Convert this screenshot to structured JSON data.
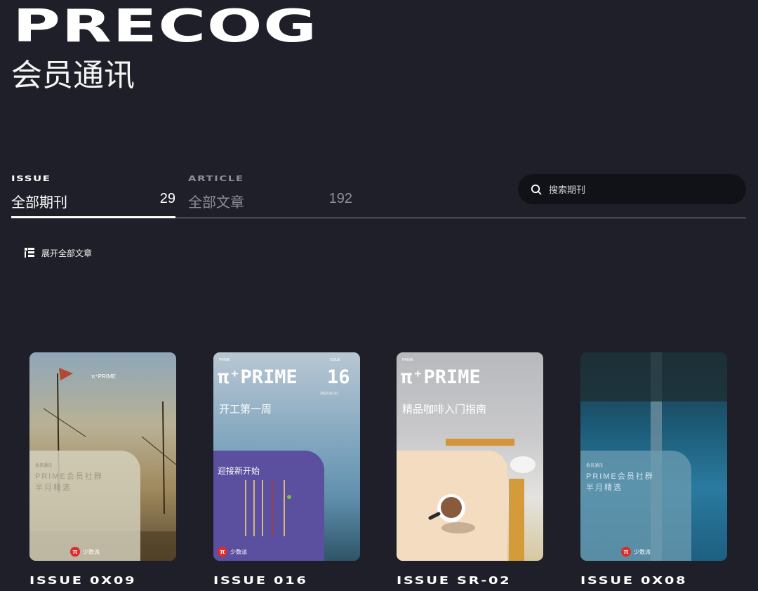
{
  "brand": "PRECOG",
  "subtitle": "会员通讯",
  "tabs": [
    {
      "kicker": "ISSUE",
      "label": "全部期刊",
      "count": "29"
    },
    {
      "kicker": "ARTICLE",
      "label": "全部文章",
      "count": "192"
    }
  ],
  "search": {
    "placeholder": "搜索期刊"
  },
  "expand_label": "展开全部文章",
  "cards": [
    {
      "caption": "ISSUE 0X09",
      "inner_lines": [
        "PRIME会员社群",
        "半月精选"
      ],
      "inner_kicker": "会员通讯",
      "brand_small": "少数派",
      "top_mark": "π⁺PRIME"
    },
    {
      "caption": "ISSUE 016",
      "title": "π⁺PRIME",
      "number": "16",
      "headline": "开工第一周",
      "inner_title": "迎接新开始",
      "brand_small": "少数派",
      "meta_left": "PRIME",
      "meta_right": "ISSUE",
      "date": "2022.02.10"
    },
    {
      "caption": "ISSUE SR-02",
      "title": "π⁺PRIME",
      "headline": "精品咖啡入门指南",
      "meta_left": "PRIME"
    },
    {
      "caption": "ISSUE 0X08",
      "inner_lines": [
        "PRIME会员社群",
        "半月精选"
      ],
      "inner_kicker": "会员通讯",
      "brand_small": "少数派"
    }
  ],
  "colors": {
    "background": "#1e1f29",
    "search_bg": "#111218",
    "card2_inner": "#5b4fa0",
    "card3_inner": "#f3dcc0"
  }
}
